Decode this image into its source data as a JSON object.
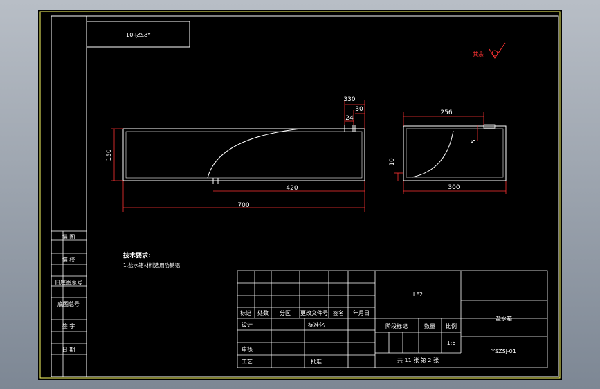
{
  "drawing": {
    "code_mirrored": "YSZSJ-01",
    "roughness_note": "其余",
    "tech_title": "技术要求:",
    "tech_item": "1.盐水箱材料选用防锈铝"
  },
  "side_labels": [
    "描 图",
    "描 校",
    "旧底图总号",
    "底图总号",
    "签 字",
    "日 期"
  ],
  "dims": {
    "d330": "330",
    "d30": "30",
    "d24": "24",
    "d150": "150",
    "d420": "420",
    "d700": "700",
    "d256": "256",
    "d5": "5",
    "d10": "10",
    "d300": "300"
  },
  "title_block": {
    "h_mark": "标记",
    "h_count": "处数",
    "h_zone": "分区",
    "h_docno": "更改文件号",
    "h_sign": "签名",
    "h_date": "年月日",
    "design": "设计",
    "standard": "标准化",
    "review": "审核",
    "process": "工艺",
    "approve": "批准",
    "material": "LF2",
    "stage": "阶段标记",
    "weight": "数量",
    "scale_label": "比例",
    "scale": "1:6",
    "sheets": "共 11 张  第 2 张",
    "part_name": "盐水箱",
    "drawing_no": "YSZSJ-01"
  }
}
